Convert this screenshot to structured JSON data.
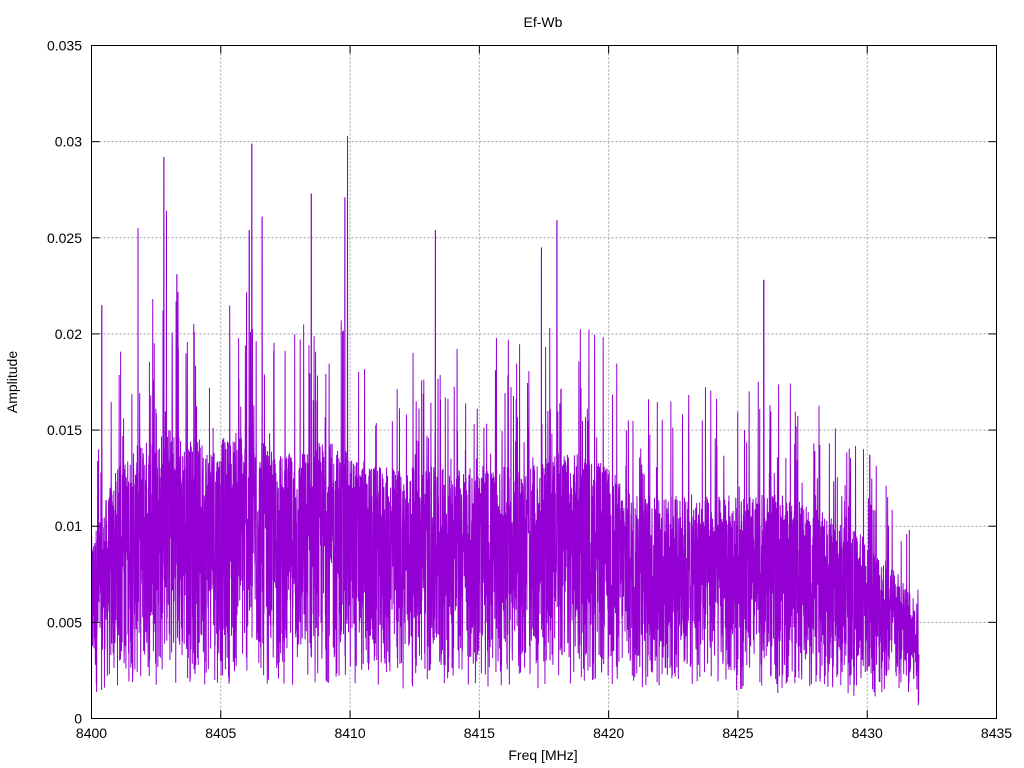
{
  "chart_data": {
    "type": "line",
    "title": "Ef-Wb",
    "xlabel": "Freq [MHz]",
    "ylabel": "Amplitude",
    "xlim": [
      8400,
      8435
    ],
    "ylim": [
      0,
      0.035
    ],
    "grid": true,
    "legend": "none",
    "xticks": [
      "8400",
      "8405",
      "8410",
      "8415",
      "8420",
      "8425",
      "8430",
      "8435"
    ],
    "yticks": [
      "0",
      "0.005",
      "0.01",
      "0.015",
      "0.02",
      "0.025",
      "0.03",
      "0.035"
    ],
    "series": [
      {
        "name": "Ef-Wb",
        "color": "#9400D3",
        "x_range": [
          8400,
          8432
        ],
        "envelope_x": [
          8400,
          8401,
          8402,
          8403,
          8404,
          8405,
          8406,
          8407,
          8408,
          8409,
          8410,
          8411,
          8412,
          8413,
          8414,
          8415,
          8416,
          8417,
          8418,
          8419,
          8420,
          8421,
          8422,
          8423,
          8424,
          8425,
          8426,
          8427,
          8428,
          8429,
          8430,
          8431,
          8432
        ],
        "envelope_upper": [
          0.013,
          0.018,
          0.02,
          0.021,
          0.02,
          0.02,
          0.021,
          0.019,
          0.019,
          0.02,
          0.019,
          0.018,
          0.018,
          0.018,
          0.018,
          0.018,
          0.018,
          0.018,
          0.019,
          0.019,
          0.018,
          0.016,
          0.016,
          0.016,
          0.016,
          0.016,
          0.016,
          0.016,
          0.015,
          0.014,
          0.013,
          0.011,
          0.008
        ],
        "peaks": [
          {
            "x": 8400.4,
            "y": 0.0215
          },
          {
            "x": 8401.8,
            "y": 0.0255
          },
          {
            "x": 8402.8,
            "y": 0.0292
          },
          {
            "x": 8402.9,
            "y": 0.0264
          },
          {
            "x": 8403.3,
            "y": 0.0231
          },
          {
            "x": 8406.1,
            "y": 0.0254
          },
          {
            "x": 8406.2,
            "y": 0.0299
          },
          {
            "x": 8406.6,
            "y": 0.0261
          },
          {
            "x": 8408.5,
            "y": 0.0273
          },
          {
            "x": 8409.8,
            "y": 0.0271
          },
          {
            "x": 8409.9,
            "y": 0.0303
          },
          {
            "x": 8413.3,
            "y": 0.0254
          },
          {
            "x": 8417.4,
            "y": 0.0245
          },
          {
            "x": 8418.0,
            "y": 0.0259
          },
          {
            "x": 8426.0,
            "y": 0.0228
          }
        ]
      }
    ]
  }
}
